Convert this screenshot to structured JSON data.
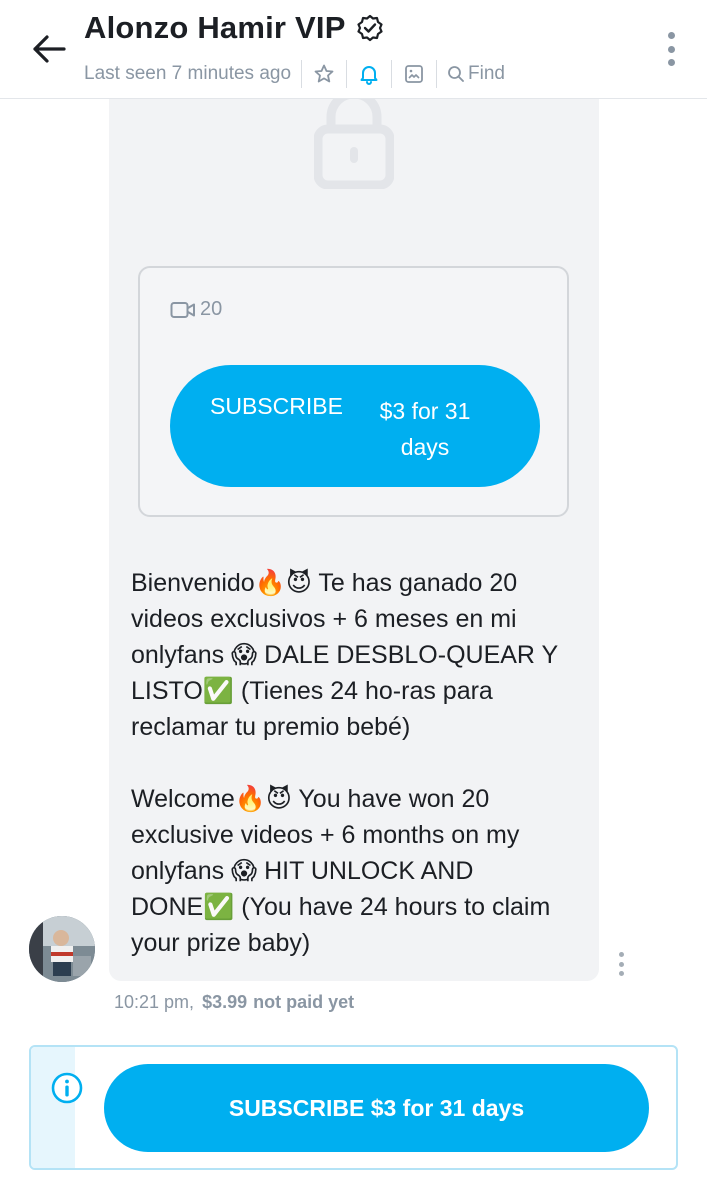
{
  "header": {
    "title": "Alonzo Hamir VIP",
    "last_seen": "Last seen 7 minutes ago",
    "find_label": "Find",
    "icons": [
      "back-arrow-icon",
      "verified-badge-icon",
      "star-icon",
      "bell-icon",
      "image-icon",
      "search-icon",
      "more-vertical-icon"
    ]
  },
  "message": {
    "locked_media": {
      "video_count": "20",
      "subscribe_label": "SUBSCRIBE",
      "subscribe_price": "$3 for 31 days"
    },
    "text_es": "Bienvenido🔥😈 Te has ganado 20 videos exclusivos + 6 meses en mi onlyfans 😱 DALE DESBLO-QUEAR Y LISTO✅ (Tienes 24 ho-ras para reclamar tu premio bebé)",
    "text_en": "Welcome🔥😈 You have won 20 exclusive videos + 6 months on my onlyfans 😱 HIT UNLOCK AND DONE✅ (You have 24 hours to claim your prize baby)",
    "time": "10:21 pm,",
    "price": "$3.99",
    "price_status": "not paid yet"
  },
  "bottom_bar": {
    "button_label": "SUBSCRIBE $3 for 31 days"
  },
  "colors": {
    "accent": "#00aff0",
    "muted": "#8a96a3",
    "bubble": "#f2f3f5"
  }
}
